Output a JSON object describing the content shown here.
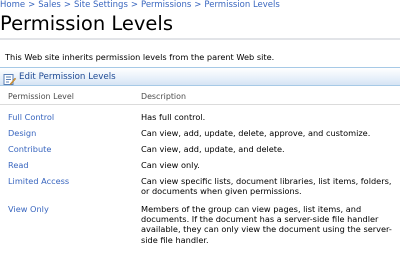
{
  "breadcrumb": {
    "items": [
      "Home",
      "Sales",
      "Site Settings",
      "Permissions"
    ],
    "separator": ">",
    "current": "Permission Levels"
  },
  "page": {
    "title": "Permission Levels",
    "inherit_message": "This Web site inherits permission levels from the parent Web site."
  },
  "toolbar": {
    "edit_label": "Edit Permission Levels",
    "edit_icon": "edit-list-icon"
  },
  "table": {
    "headers": [
      "Permission Level",
      "Description"
    ],
    "rows": [
      {
        "level": "Full Control",
        "description": "Has full control."
      },
      {
        "level": "Design",
        "description": "Can view, add, update, delete, approve, and customize."
      },
      {
        "level": "Contribute",
        "description": "Can view, add, update, and delete."
      },
      {
        "level": "Read",
        "description": "Can view only."
      },
      {
        "level": "Limited Access",
        "description": "Can view specific lists, document libraries, list items, folders, or documents when given permissions."
      },
      {
        "level": "View Only",
        "description": "Members of the group can view pages, list items, and documents. If the document has a server-side file handler available, they can only view the document using the server-side file handler."
      }
    ]
  },
  "colors": {
    "link": "#3966bf",
    "toolbar_border": "#a6c9e6",
    "toolbar_label": "#1f4a94"
  }
}
